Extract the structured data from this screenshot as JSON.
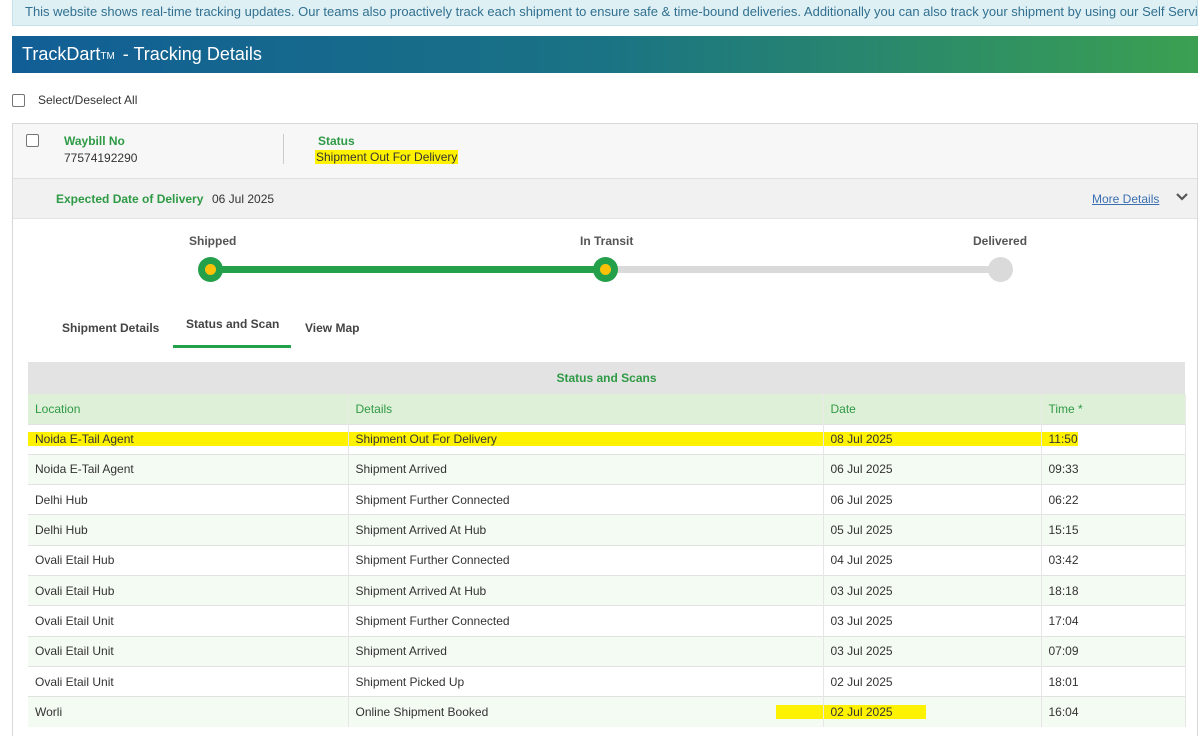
{
  "notice": "This website shows real-time tracking updates. Our teams also proactively track each shipment to ensure safe & time-bound deliveries. Additionally you can also track your shipment by using our Self Service Mobile APP.",
  "header": {
    "title_prefix": "TrackDart",
    "trademark": "TM",
    "title_suffix": " - Tracking Details"
  },
  "select_all": {
    "label": "Select/Deselect All",
    "checked": false
  },
  "shipment": {
    "waybill_label": "Waybill No",
    "waybill_no": "77574192290",
    "status_label": "Status",
    "status_value": "Shipment Out For Delivery",
    "edd_label": "Expected Date of Delivery",
    "edd_value": "06 Jul 2025",
    "more_details": "More Details",
    "progress": {
      "steps": [
        {
          "label": "Shipped",
          "state": "completed"
        },
        {
          "label": "In Transit",
          "state": "current"
        },
        {
          "label": "Delivered",
          "state": "pending"
        }
      ],
      "completed_color": "#24a04a",
      "pending_color": "#dadada",
      "current_dot_color": "#ffc107"
    }
  },
  "tabs": [
    {
      "label": "Shipment Details",
      "active": false
    },
    {
      "label": "Status and Scan",
      "active": true
    },
    {
      "label": "View Map",
      "active": false
    }
  ],
  "scan_table": {
    "caption": "Status and Scans",
    "columns": [
      "Location",
      "Details",
      "Date",
      "Time *"
    ],
    "rows": [
      {
        "location": "Noida E-Tail Agent",
        "details": "Shipment Out For Delivery",
        "date": "08 Jul 2025",
        "time": "11:50",
        "highlighted": true
      },
      {
        "location": "Noida E-Tail Agent",
        "details": "Shipment Arrived",
        "date": "06 Jul 2025",
        "time": "09:33"
      },
      {
        "location": "Delhi Hub",
        "details": "Shipment Further Connected",
        "date": "06 Jul 2025",
        "time": "06:22"
      },
      {
        "location": "Delhi Hub",
        "details": "Shipment Arrived At Hub",
        "date": "05 Jul 2025",
        "time": "15:15"
      },
      {
        "location": "Ovali Etail Hub",
        "details": "Shipment Further Connected",
        "date": "04 Jul 2025",
        "time": "03:42"
      },
      {
        "location": "Ovali Etail Hub",
        "details": "Shipment Arrived At Hub",
        "date": "03 Jul 2025",
        "time": "18:18"
      },
      {
        "location": "Ovali Etail Unit",
        "details": "Shipment Further Connected",
        "date": "03 Jul 2025",
        "time": "17:04"
      },
      {
        "location": "Ovali Etail Unit",
        "details": "Shipment Arrived",
        "date": "03 Jul 2025",
        "time": "07:09"
      },
      {
        "location": "Ovali Etail Unit",
        "details": "Shipment Picked Up",
        "date": "02 Jul 2025",
        "time": "18:01"
      },
      {
        "location": "Worli",
        "details": "Online Shipment Booked",
        "date": "02 Jul 2025",
        "time": "16:04",
        "date_highlighted": true
      }
    ]
  },
  "colors": {
    "brand_green": "#2e9a45",
    "header_gradient_start": "#115e96",
    "header_gradient_end": "#3ba051",
    "highlight": "#fff200",
    "link_blue": "#3a6fb0"
  }
}
